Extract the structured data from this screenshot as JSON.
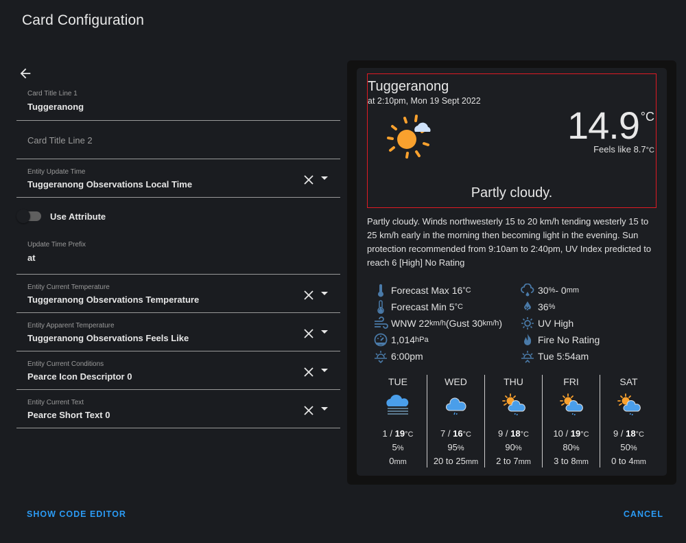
{
  "dialog": {
    "title": "Card Configuration"
  },
  "editor": {
    "back_icon": "arrow-left-icon",
    "title_line_1": {
      "label": "Card Title Line 1",
      "value": "Tuggeranong"
    },
    "title_line_2": {
      "placeholder": "Card Title Line 2",
      "value": ""
    },
    "entity_update_time": {
      "label": "Entity Update Time",
      "value": "Tuggeranong Observations Local Time"
    },
    "use_attribute": {
      "label": "Use Attribute",
      "checked": false
    },
    "update_time_prefix": {
      "label": "Update Time Prefix",
      "value": "at"
    },
    "entity_current_temperature": {
      "label": "Entity Current Temperature",
      "value": "Tuggeranong Observations Temperature"
    },
    "entity_apparent_temperature": {
      "label": "Entity Apparent Temperature",
      "value": "Tuggeranong Observations Feels Like"
    },
    "entity_current_conditions": {
      "label": "Entity Current Conditions",
      "value": "Pearce Icon Descriptor 0"
    },
    "entity_current_text": {
      "label": "Entity Current Text",
      "value": "Pearce Short Text 0"
    }
  },
  "preview": {
    "title": "Tuggeranong",
    "update_time": "at 2:10pm, Mon 19 Sept 2022",
    "current_icon": "partly-cloudy-day-icon",
    "temperature": "14.9",
    "temperature_unit": "°C",
    "feels_like": "Feels like 8.7",
    "feels_like_unit": "°C",
    "condition": "Partly cloudy.",
    "extended": "Partly cloudy. Winds northwesterly 15 to 20 km/h tending westerly 15 to 25 km/h early in the morning then becoming light in the evening. Sun protection recommended from 9:10am to 2:40pm, UV Index predicted to reach 6 [High] No Rating",
    "slots_left": [
      {
        "icon": "thermometer-high-icon",
        "text": "Forecast Max 16",
        "unit": "°C"
      },
      {
        "icon": "thermometer-low-icon",
        "text": "Forecast Min 5",
        "unit": "°C"
      },
      {
        "icon": "wind-icon",
        "text": "WNW 22",
        "unit": "km/h",
        "text2": " (Gust 30",
        "unit2": "km/h",
        "text3": ")"
      },
      {
        "icon": "gauge-icon",
        "text": "1,014",
        "unit": "hPa"
      },
      {
        "icon": "sunset-icon",
        "text": "6:00pm",
        "unit": ""
      }
    ],
    "slots_right": [
      {
        "icon": "rain-cloud-icon",
        "text": "30",
        "unit": "%",
        "text2": " - 0",
        "unit2": "mm"
      },
      {
        "icon": "humidity-icon",
        "text": "36",
        "unit": "%"
      },
      {
        "icon": "uv-sun-icon",
        "text": "UV High",
        "unit": ""
      },
      {
        "icon": "fire-icon",
        "text": "Fire No Rating",
        "unit": ""
      },
      {
        "icon": "sunrise-icon",
        "text": "Tue 5:54am",
        "unit": ""
      }
    ],
    "daily": [
      {
        "day": "TUE",
        "icon": "fog-cloud-icon",
        "min": "1",
        "max": "19",
        "unit": "°C",
        "pop": "5",
        "pop_unit": "%",
        "rain": "0",
        "rain_unit": "mm"
      },
      {
        "day": "WED",
        "icon": "showers-icon",
        "min": "7",
        "max": "16",
        "unit": "°C",
        "pop": "95",
        "pop_unit": "%",
        "rain": "20 to 25",
        "rain_unit": "mm"
      },
      {
        "day": "THU",
        "icon": "partly-cloudy-showers-icon",
        "min": "9",
        "max": "18",
        "unit": "°C",
        "pop": "90",
        "pop_unit": "%",
        "rain": "2 to 7",
        "rain_unit": "mm"
      },
      {
        "day": "FRI",
        "icon": "partly-cloudy-showers-icon",
        "min": "10",
        "max": "19",
        "unit": "°C",
        "pop": "80",
        "pop_unit": "%",
        "rain": "3 to 8",
        "rain_unit": "mm"
      },
      {
        "day": "SAT",
        "icon": "partly-cloudy-showers-icon",
        "min": "9",
        "max": "18",
        "unit": "°C",
        "pop": "50",
        "pop_unit": "%",
        "rain": "0 to 4",
        "rain_unit": "mm"
      }
    ]
  },
  "footer": {
    "show_code_editor": "SHOW CODE EDITOR",
    "cancel": "CANCEL"
  },
  "colors": {
    "accent": "#2b9af3",
    "sun": "#f9a12e",
    "cloud": "#4a9eea",
    "slot_icon": "#4a7aa8",
    "highlight_border": "#e01b24"
  }
}
